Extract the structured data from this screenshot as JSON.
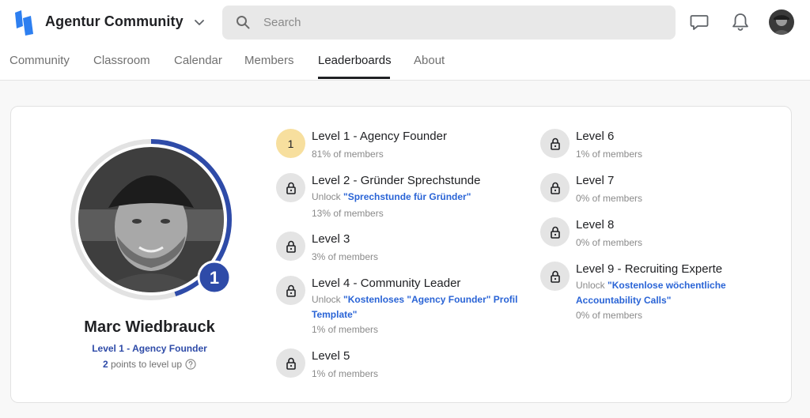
{
  "app": {
    "brand": "Agentur Community",
    "search_placeholder": "Search",
    "colors": {
      "accent": "#2e4ba8",
      "link": "#2a64d6",
      "current_level": "#f7df9e"
    }
  },
  "tabs": [
    {
      "label": "Community"
    },
    {
      "label": "Classroom"
    },
    {
      "label": "Calendar"
    },
    {
      "label": "Members"
    },
    {
      "label": "Leaderboards",
      "active": true
    },
    {
      "label": "About"
    }
  ],
  "profile": {
    "name": "Marc Wiedbrauck",
    "level_label": "Level 1 - Agency Founder",
    "level_number": "1",
    "points_value": "2",
    "points_text": " points to level up",
    "progress_fraction": 0.45
  },
  "levels": [
    {
      "badge": "1",
      "title": "Level 1 - Agency Founder",
      "members": "81% of members",
      "current": true
    },
    {
      "title": "Level 2 - Gründer Sprechstunde",
      "unlock_prefix": "Unlock ",
      "unlock_link": "\"Sprechstunde für Gründer\"",
      "members": "13% of members",
      "icon": "lock-icon"
    },
    {
      "title": "Level 3",
      "members": "3% of members",
      "icon": "lock-icon"
    },
    {
      "title": "Level 4 - Community Leader",
      "unlock_prefix": "Unlock ",
      "unlock_link": "\"Kostenloses \"Agency Founder\" Profil Template\"",
      "members": "1% of members",
      "icon": "lock-icon"
    },
    {
      "title": "Level 5",
      "members": "1% of members",
      "icon": "lock-icon"
    },
    {
      "title": "Level 6",
      "members": "1% of members",
      "icon": "lock-icon"
    },
    {
      "title": "Level 7",
      "members": "0% of members",
      "icon": "lock-icon"
    },
    {
      "title": "Level 8",
      "members": "0% of members",
      "icon": "lock-icon"
    },
    {
      "title": "Level 9 - Recruiting Experte",
      "unlock_prefix": "Unlock ",
      "unlock_link": "\"Kostenlose wöchentliche Accountability Calls\"",
      "members": "0% of members",
      "icon": "lock-icon"
    }
  ]
}
